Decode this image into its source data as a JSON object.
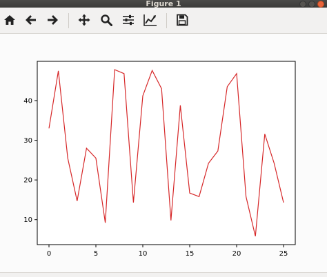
{
  "window": {
    "title": "Figure 1"
  },
  "toolbar": {
    "tools": [
      {
        "name": "home",
        "icon": "home-icon"
      },
      {
        "name": "back",
        "icon": "arrow-left-icon"
      },
      {
        "name": "forward",
        "icon": "arrow-right-icon"
      },
      {
        "name": "pan",
        "icon": "move-icon"
      },
      {
        "name": "zoom",
        "icon": "zoom-icon"
      },
      {
        "name": "subplots",
        "icon": "sliders-icon"
      },
      {
        "name": "edit-axes",
        "icon": "line-chart-icon"
      },
      {
        "name": "save",
        "icon": "save-icon"
      }
    ]
  },
  "colors": {
    "line": "#d62728",
    "axes": "#000000",
    "canvas": "#fbfbfb",
    "toolbar": "#f2f1f0"
  },
  "chart_data": {
    "type": "line",
    "x": [
      0,
      1,
      2,
      3,
      4,
      5,
      6,
      7,
      8,
      9,
      10,
      11,
      12,
      13,
      14,
      15,
      16,
      17,
      18,
      19,
      20,
      21,
      22,
      23,
      24,
      25
    ],
    "series": [
      {
        "values": [
          33,
          47.5,
          25.5,
          14.7,
          28,
          25.5,
          9.2,
          47.8,
          46.8,
          14.3,
          41.2,
          47.6,
          43,
          9.8,
          38.8,
          16.7,
          15.8,
          24.2,
          27.3,
          43.5,
          46.8,
          15.8,
          5.8,
          31.6,
          24.2,
          14.3
        ],
        "color": "#d62728"
      }
    ],
    "xlim": [
      -1.25,
      26.25
    ],
    "ylim": [
      3.7,
      49.9
    ],
    "xticks": [
      0,
      5,
      10,
      15,
      20,
      25
    ],
    "yticks": [
      10,
      20,
      30,
      40
    ],
    "xtick_labels": [
      "0",
      "5",
      "10",
      "15",
      "20",
      "25"
    ],
    "ytick_labels": [
      "10",
      "20",
      "30",
      "40"
    ],
    "title": "",
    "xlabel": "",
    "ylabel": "",
    "grid": false
  }
}
